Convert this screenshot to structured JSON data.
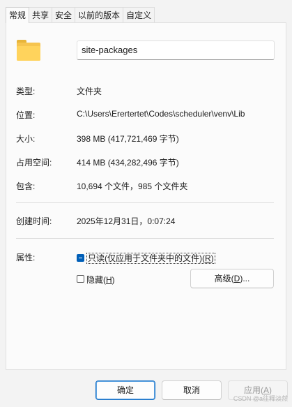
{
  "tabs": [
    "常规",
    "共享",
    "安全",
    "以前的版本",
    "自定义"
  ],
  "active_tab": "常规",
  "folder_icon": "folder-icon",
  "folder_name": "site-packages",
  "fields": {
    "type_label": "类型:",
    "type_value": "文件夹",
    "location_label": "位置:",
    "location_value": "C:\\Users\\Erertertet\\Codes\\scheduler\\venv\\Lib",
    "size_label": "大小:",
    "size_value": "398 MB (417,721,469 字节)",
    "disk_size_label": "占用空间:",
    "disk_size_value": "414 MB (434,282,496 字节)",
    "contains_label": "包含:",
    "contains_value": "10,694 个文件，985 个文件夹",
    "created_label": "创建时间:",
    "created_value": "2025年12月31日，0:07:24",
    "attributes_label": "属性:"
  },
  "attributes": {
    "readonly_label_pre": "只读(仅应用于文件夹中的文件)(",
    "readonly_key": "R",
    "readonly_label_post": ")",
    "readonly_state": "indeterminate",
    "hidden_label_pre": "隐藏(",
    "hidden_key": "H",
    "hidden_label_post": ")",
    "hidden_state": "unchecked",
    "advanced_pre": "高级(",
    "advanced_key": "D",
    "advanced_post": ")..."
  },
  "buttons": {
    "ok": "确定",
    "cancel": "取消",
    "apply_pre": "应用(",
    "apply_key": "A",
    "apply_post": ")"
  },
  "watermark": "CSDN @a往释淡然",
  "colors": {
    "accent": "#005fb8",
    "folder": "#ffd35c"
  }
}
